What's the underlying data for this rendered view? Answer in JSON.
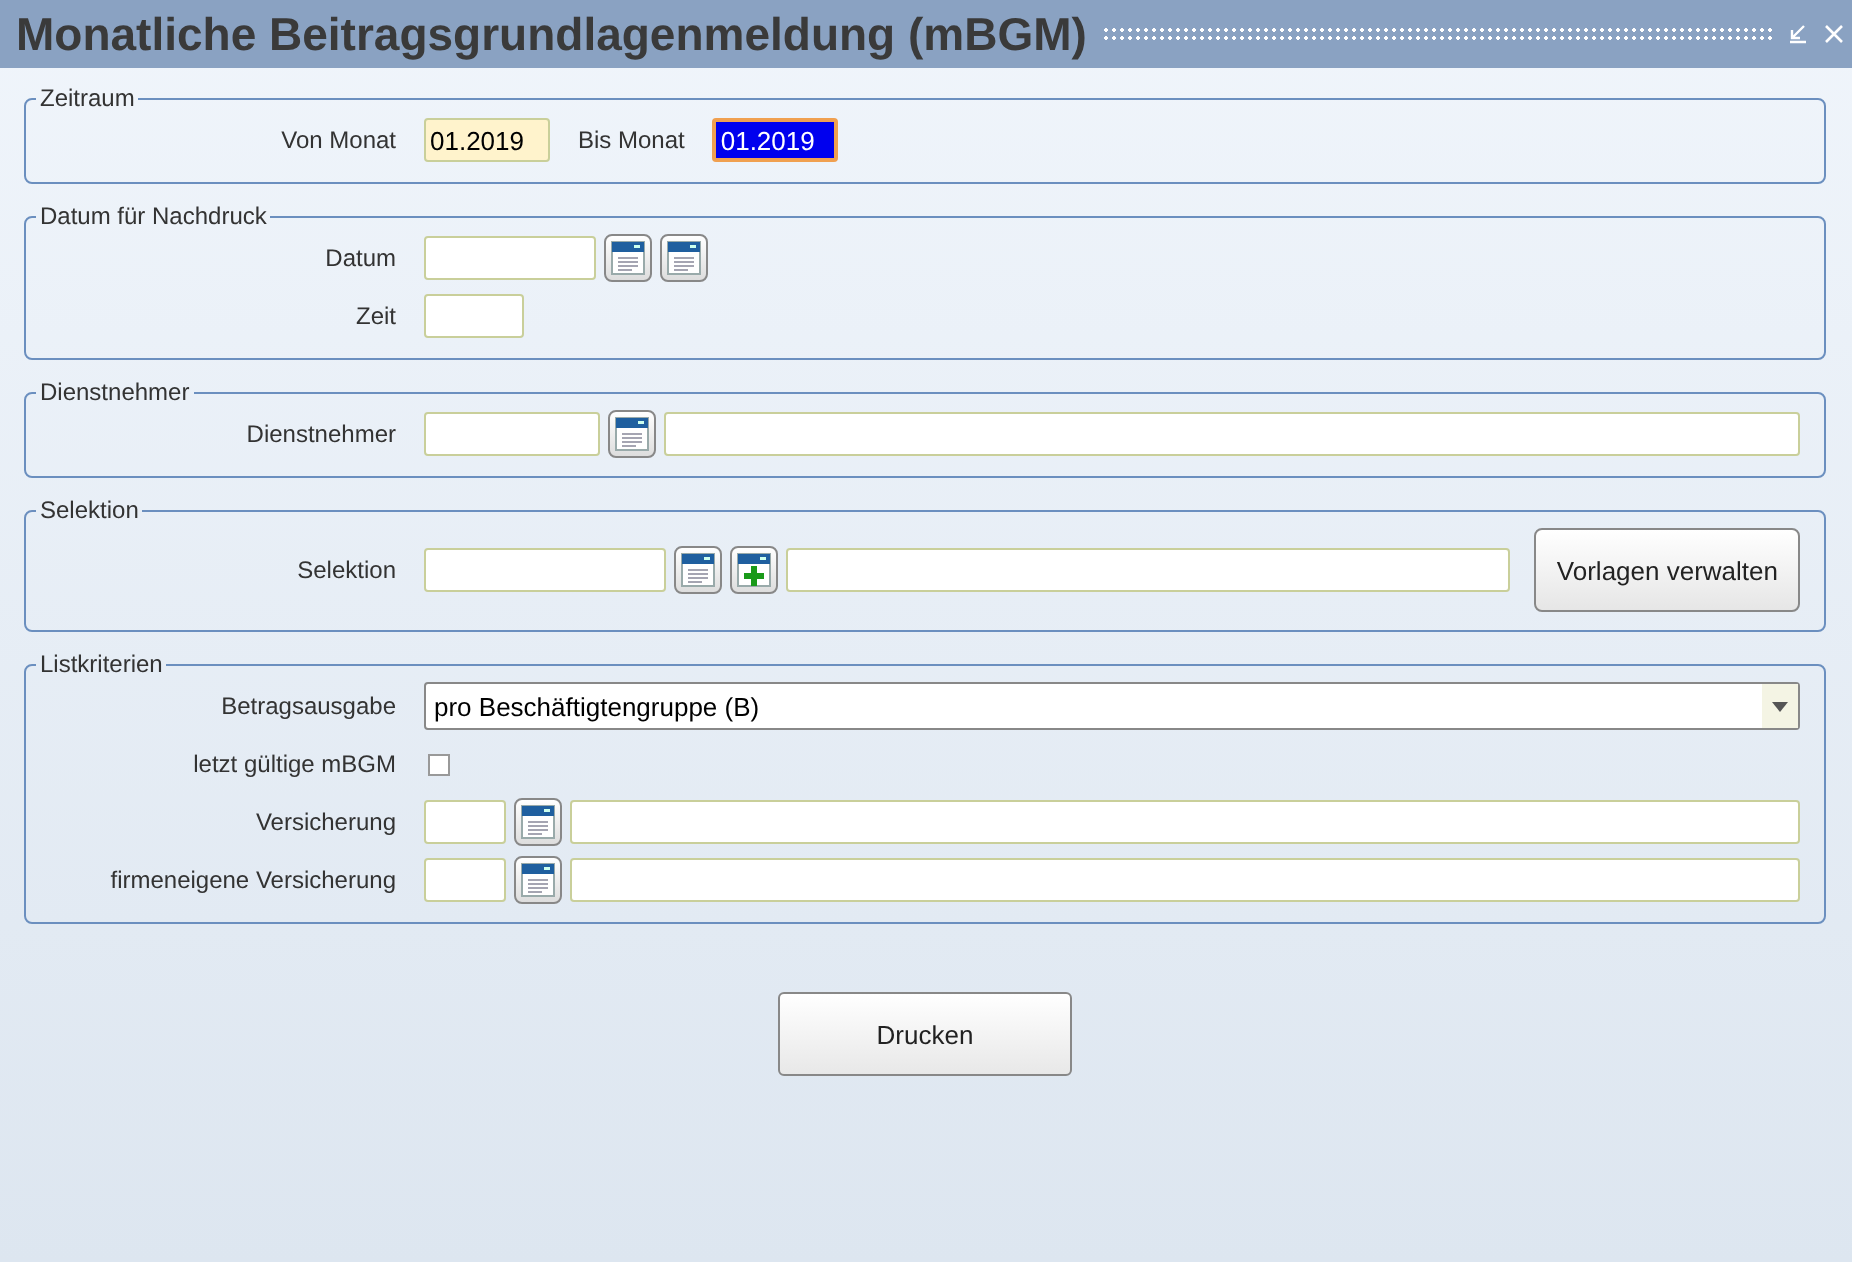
{
  "window": {
    "title": "Monatliche Beitragsgrundlagenmeldung (mBGM)"
  },
  "sections": [
    {
      "title": "Zeitraum",
      "rows": [
        {
          "label": "Von Monat",
          "controls": [
            {
              "kind": "month",
              "value": "01.2019",
              "highlighted": true,
              "focused": false
            },
            {
              "kind": "inline-label",
              "text": "Bis Monat"
            },
            {
              "kind": "month",
              "value": "01.2019",
              "highlighted": false,
              "focused": true
            }
          ]
        }
      ]
    },
    {
      "title": "Datum für Nachdruck",
      "rows": [
        {
          "label": "Datum",
          "controls": [
            {
              "kind": "date"
            },
            {
              "kind": "lookup"
            },
            {
              "kind": "lookup"
            }
          ]
        },
        {
          "label": "Zeit",
          "controls": [
            {
              "kind": "time"
            }
          ]
        }
      ]
    },
    {
      "title": "Dienstnehmer",
      "rows": [
        {
          "label": "Dienstnehmer",
          "controls": [
            {
              "kind": "id"
            },
            {
              "kind": "lookup"
            },
            {
              "kind": "name"
            }
          ]
        }
      ]
    },
    {
      "title": "Selektion",
      "rows": [
        {
          "label": "Selektion",
          "controls": [
            {
              "kind": "selection"
            },
            {
              "kind": "lookup"
            },
            {
              "kind": "add"
            },
            {
              "kind": "name"
            },
            {
              "kind": "button",
              "text": "Vorlagen verwalten"
            }
          ]
        }
      ]
    },
    {
      "title": "Listkriterien",
      "rows": [
        {
          "label": "Betragsausgabe",
          "controls": [
            {
              "kind": "select",
              "value": "pro Beschäftigtengruppe (B)"
            }
          ]
        },
        {
          "label": "letzt gültige mBGM",
          "controls": [
            {
              "kind": "checkbox",
              "checked": false
            }
          ]
        },
        {
          "label": "Versicherung",
          "controls": [
            {
              "kind": "code"
            },
            {
              "kind": "lookup"
            },
            {
              "kind": "name"
            }
          ]
        },
        {
          "label": "firmeneigene Versicherung",
          "controls": [
            {
              "kind": "code"
            },
            {
              "kind": "lookup"
            },
            {
              "kind": "name"
            }
          ]
        }
      ]
    }
  ],
  "print_button": "Drucken"
}
